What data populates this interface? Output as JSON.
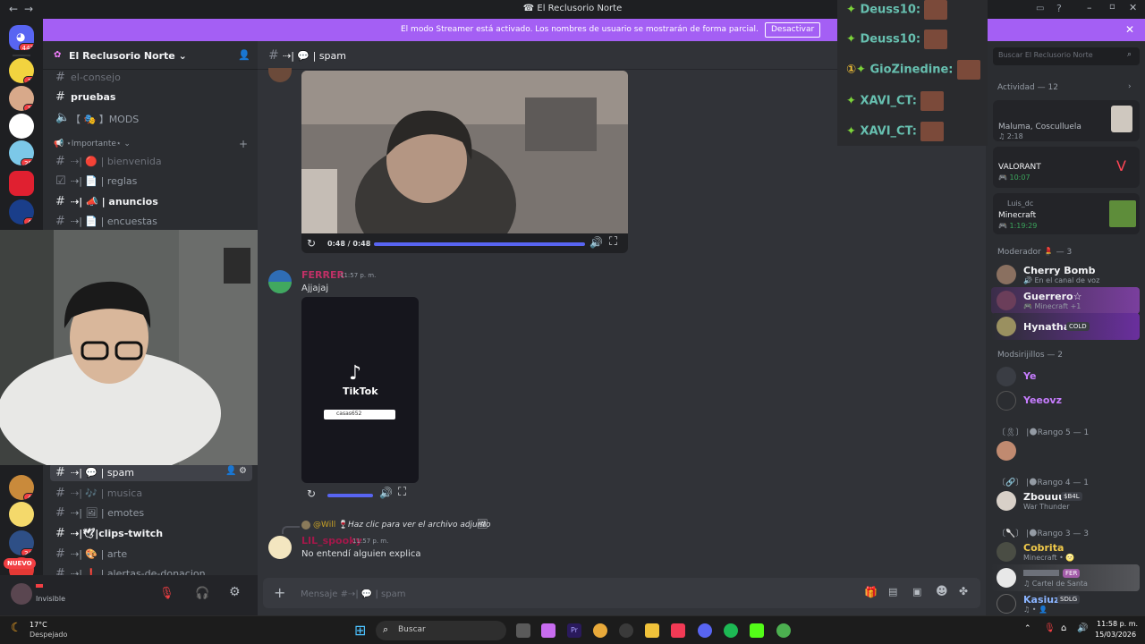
{
  "window": {
    "title": "El Reclusorio Norte"
  },
  "banner": {
    "text": "El modo Streamer está activado. Los nombres de usuario se mostrarán de forma parcial.",
    "button": "Desactivar"
  },
  "rail": {
    "home_badge": "442",
    "badges": [
      "1",
      "1",
      "29",
      "4",
      "4",
      "24"
    ],
    "new_label": "NUEVO"
  },
  "server": {
    "name": "El Reclusorio Norte"
  },
  "channels": {
    "top": [
      {
        "label": "el-consejo",
        "style": "muted"
      },
      {
        "label": "pruebas",
        "style": "bright"
      },
      {
        "label": "【 🎭 】MODS",
        "style": "normal"
      }
    ],
    "category": "⋆Importante⋆",
    "important": [
      {
        "label": "⇢| 🔴 | bienvenida",
        "style": "muted"
      },
      {
        "label": "⇢| 📄 | reglas",
        "style": "normal"
      },
      {
        "label": "⇢| 📣 | anuncios",
        "style": "bright"
      },
      {
        "label": "⇢| 📄 | encuestas",
        "style": "normal"
      }
    ],
    "bottom": [
      {
        "label": "⇢| 💬 | spam",
        "style": "active"
      },
      {
        "label": "⇢| 🎶 | musica",
        "style": "muted"
      },
      {
        "label": "⇢| 🖼 | emotes",
        "style": "normal"
      },
      {
        "label": "⇢|🕊|clips-twitch",
        "style": "bright"
      },
      {
        "label": "⇢| 🎨 | arte",
        "style": "normal"
      },
      {
        "label": "⇢| ❗ | alertas-de-donacion",
        "style": "normal"
      }
    ]
  },
  "user": {
    "status": "Invisible"
  },
  "chat": {
    "channel": "⇢| 💬 | spam",
    "video1": {
      "time": "0:48 / 0:48"
    },
    "messages": [
      {
        "author": "FERRER",
        "time": "11:57 p. m.",
        "text": "Ajjajaj"
      },
      {
        "author": "LIL_spooky",
        "time": "11:57 p. m.",
        "text": "No entendí alguien explica"
      }
    ],
    "tiktok": {
      "brand": "TikTok",
      "search": "casas652"
    },
    "reply": {
      "name": "@Will 🍷",
      "text": "Haz clic para ver el archivo adjunto"
    },
    "composer_placeholder": "Mensaje #⇢| 💬 | spam"
  },
  "overlay": {
    "lines": [
      "Deuss10:",
      "Deuss10:",
      "GioZinedine:",
      "XAVI_CT:",
      "XAVI_CT:"
    ]
  },
  "members": {
    "search_placeholder": "Buscar El Reclusorio Norte",
    "activity_header": "Actividad — 12",
    "activities": [
      {
        "title": "Maluma, Cosculluela",
        "sub": "♫ 2:18"
      },
      {
        "title": "VALORANT",
        "sub": "🎮 10:07"
      },
      {
        "user": "Luis_dc",
        "title": "Minecraft",
        "sub": "🎮 1:19:29"
      }
    ],
    "groups": [
      {
        "name": "Moderador 💄 — 3",
        "members": [
          {
            "name": "Cherry Bomb",
            "status": "🔊 En el canal de voz",
            "color": "#f2f3f5"
          },
          {
            "name": "Guerrero☆",
            "status": "🎮 Minecraft +1",
            "color": "#f2f3f5"
          },
          {
            "name": "Hynathal",
            "status": "",
            "tag": "COLD",
            "color": "#f2f3f5"
          }
        ]
      },
      {
        "name": "Modsirijillos — 2",
        "members": [
          {
            "name": "Ye",
            "status": "",
            "color": "#c77dff"
          },
          {
            "name": "Yeeovz",
            "status": "",
            "color": "#c77dff"
          }
        ]
      },
      {
        "name": "〔🎗〕 |🌑Rango 5 — 1",
        "members": [
          {
            "name": "",
            "status": "",
            "color": "#f2f3f5"
          }
        ]
      },
      {
        "name": "〔🔗〕 |🌑Rango 4 — 1",
        "members": [
          {
            "name": "Zbouuu",
            "status": "War Thunder",
            "tag": "$B4L",
            "color": "#f2f3f5"
          }
        ]
      },
      {
        "name": "〔🥄〕 |🌑Rango 3 — 3",
        "members": [
          {
            "name": "Cobrita",
            "status": "Minecraft • 🌝",
            "color": "#f0c94a"
          },
          {
            "name": "",
            "status": "♫ Cartel de Santa",
            "tag": "FER",
            "color": "#f2f3f5"
          },
          {
            "name": "Kasiuz",
            "status": "♫ • 👤",
            "tag": "SDLG",
            "color": "#8ab4ff"
          }
        ]
      }
    ]
  },
  "taskbar": {
    "weather_temp": "17°C",
    "weather_desc": "Despejado",
    "search": "Buscar",
    "time": "11:58 p. m.",
    "date": "15/03/2026"
  }
}
